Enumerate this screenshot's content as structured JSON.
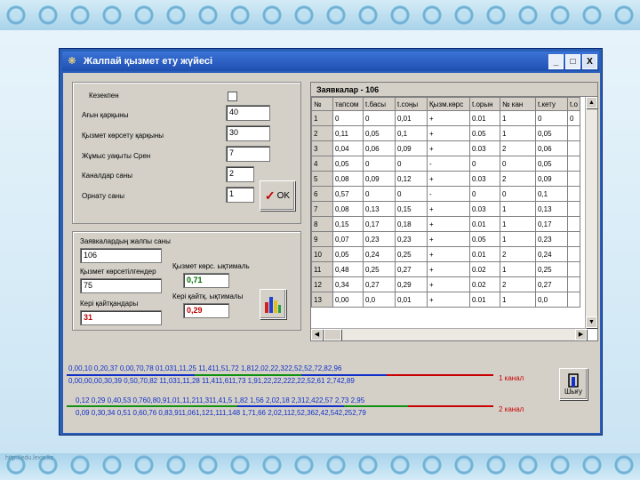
{
  "window": {
    "title": "Жалпай қызмет ету жүйесі",
    "buttons": [
      "_",
      "□",
      "X"
    ]
  },
  "params": {
    "checkbox_label": "Кезекпен",
    "items": [
      {
        "label": "Ағын қарқыны",
        "value": "40"
      },
      {
        "label": "Қызмет көрсету қарқыны",
        "value": "30"
      },
      {
        "label": "Жұмыс уақыты Срен",
        "value": "7"
      },
      {
        "label": "Каналдар саны",
        "value": "2"
      },
      {
        "label": "Орнату саны",
        "value": "1"
      }
    ],
    "ok_label": "OK",
    "ok_icon": "✓"
  },
  "results": {
    "total_label": "Заявкалардың жалпы саны",
    "total_value": "106",
    "served_label": "Қызмет көрсетілгендер",
    "served_value": "75",
    "served_prob_label": "Қызмет көрс. ықтималь",
    "served_prob_value": "0,71",
    "rejected_label": "Кері қайтқандары",
    "rejected_value": "31",
    "rejected_prob_label": "Кері қайтқ. ықтималы",
    "rejected_prob_value": "0,29",
    "chart_icon": "bar-chart-icon"
  },
  "grid": {
    "title": "Заявкалар - 106",
    "columns": [
      "№",
      "тапсом",
      "t.басы",
      "t.соңы",
      "Қызм.көрс",
      "t.орын",
      "№ кан",
      "t.кету",
      "t.о"
    ],
    "rows": [
      [
        "1",
        "0",
        "0",
        "0,01",
        "+",
        "0.01",
        "1",
        "0",
        "0"
      ],
      [
        "2",
        "0,11",
        "0,05",
        "0,1",
        "+",
        "0.05",
        "1",
        "0,05",
        ""
      ],
      [
        "3",
        "0,04",
        "0,06",
        "0,09",
        "+",
        "0.03",
        "2",
        "0,06",
        ""
      ],
      [
        "4",
        "0,05",
        "0",
        "0",
        "-",
        "0",
        "0",
        "0,05",
        ""
      ],
      [
        "5",
        "0,08",
        "0,09",
        "0,12",
        "+",
        "0.03",
        "2",
        "0,09",
        ""
      ],
      [
        "6",
        "0,57",
        "0",
        "0",
        "-",
        "0",
        "0",
        "0,1",
        ""
      ],
      [
        "7",
        "0,08",
        "0,13",
        "0,15",
        "+",
        "0.03",
        "1",
        "0,13",
        ""
      ],
      [
        "8",
        "0,15",
        "0,17",
        "0,18",
        "+",
        "0.01",
        "1",
        "0,17",
        ""
      ],
      [
        "9",
        "0,07",
        "0,23",
        "0,23",
        "+",
        "0.05",
        "1",
        "0,23",
        ""
      ],
      [
        "10",
        "0,05",
        "0,24",
        "0,25",
        "+",
        "0.01",
        "2",
        "0,24",
        ""
      ],
      [
        "11",
        "0,48",
        "0,25",
        "0,27",
        "+",
        "0.02",
        "1",
        "0,25",
        ""
      ],
      [
        "12",
        "0,34",
        "0,27",
        "0,29",
        "+",
        "0.02",
        "2",
        "0,27",
        ""
      ],
      [
        "13",
        "0,00",
        "0,0",
        "0,01",
        "+",
        "0.01",
        "1",
        "0,0",
        ""
      ]
    ]
  },
  "timeline": {
    "rows": [
      "0,00,10 0,20,37   0,00,70,78   01,031,11,25  11,411,51,72  1,812,02,22,322,52,52,72,82,96",
      "0,00,00,00,30,39   0,50,70,82   11,031,11,28  11,411,611,73  1,91,22,22,222,22,52,61 2,742,89",
      "0,12 0,29  0,40,53   0,760,80,91,01,11,211,311,41,5   1,82 1,56 2,02,18 2,312,422,57 2,73 2,95",
      "0,09 0,30,34  0,51  0,60,76 0,83,911,061,121,111,148   1,71,66  2,02,112,52,362,42,542,252,79"
    ],
    "channel1": "1 канал",
    "channel2": "2 канал",
    "exit_label": "Шығу",
    "exit_icon": "exit-door-icon"
  },
  "colors": {
    "title_bar": "#2a5fb8",
    "line_blue": "#1030c8",
    "line_green": "#109010",
    "line_red": "#c80000"
  },
  "footer_url": "http://edu.lexis.kz"
}
